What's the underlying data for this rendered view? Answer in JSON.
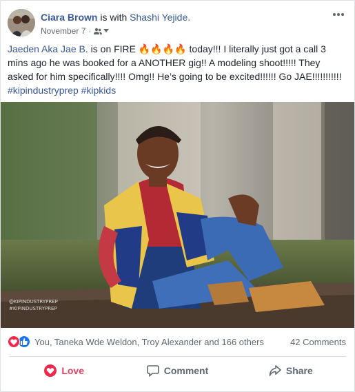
{
  "post": {
    "actor": "Ciara Brown",
    "with_text": "is with",
    "tagged": "Shashi Yejide.",
    "date": "November 7",
    "dot": "·",
    "audience_icon": "friends-icon",
    "text": {
      "mention": "Jaeden Aka Jae B.",
      "before_emoji": " is on FIRE ",
      "emoji": "🔥🔥🔥🔥",
      "after_emoji": " today!!! I literally just got a call 3 mins ago he was booked for a ANOTHER gig!! A modeling shoot!!!!! They asked for him specifically!!!! Omg!! He’s going to be excited!!!!!! Go JAE!!!!!!!!!!!",
      "hashtag1": "#kipindustryprep",
      "hashtag2": "#kipkids"
    },
    "photo_watermark": [
      "@KIPINDUSTRYPREP",
      "#KIPINDUSTRYPREP"
    ]
  },
  "reactions": {
    "icons": [
      "love-icon",
      "like-icon"
    ],
    "names": "You, Taneka Wde Weldon, Troy Alexander and 166 others",
    "comments": "42 Comments"
  },
  "actions": {
    "love": "Love",
    "comment": "Comment",
    "share": "Share"
  },
  "colors": {
    "link": "#385898",
    "love": "#e4405f",
    "like": "#1877f2"
  }
}
